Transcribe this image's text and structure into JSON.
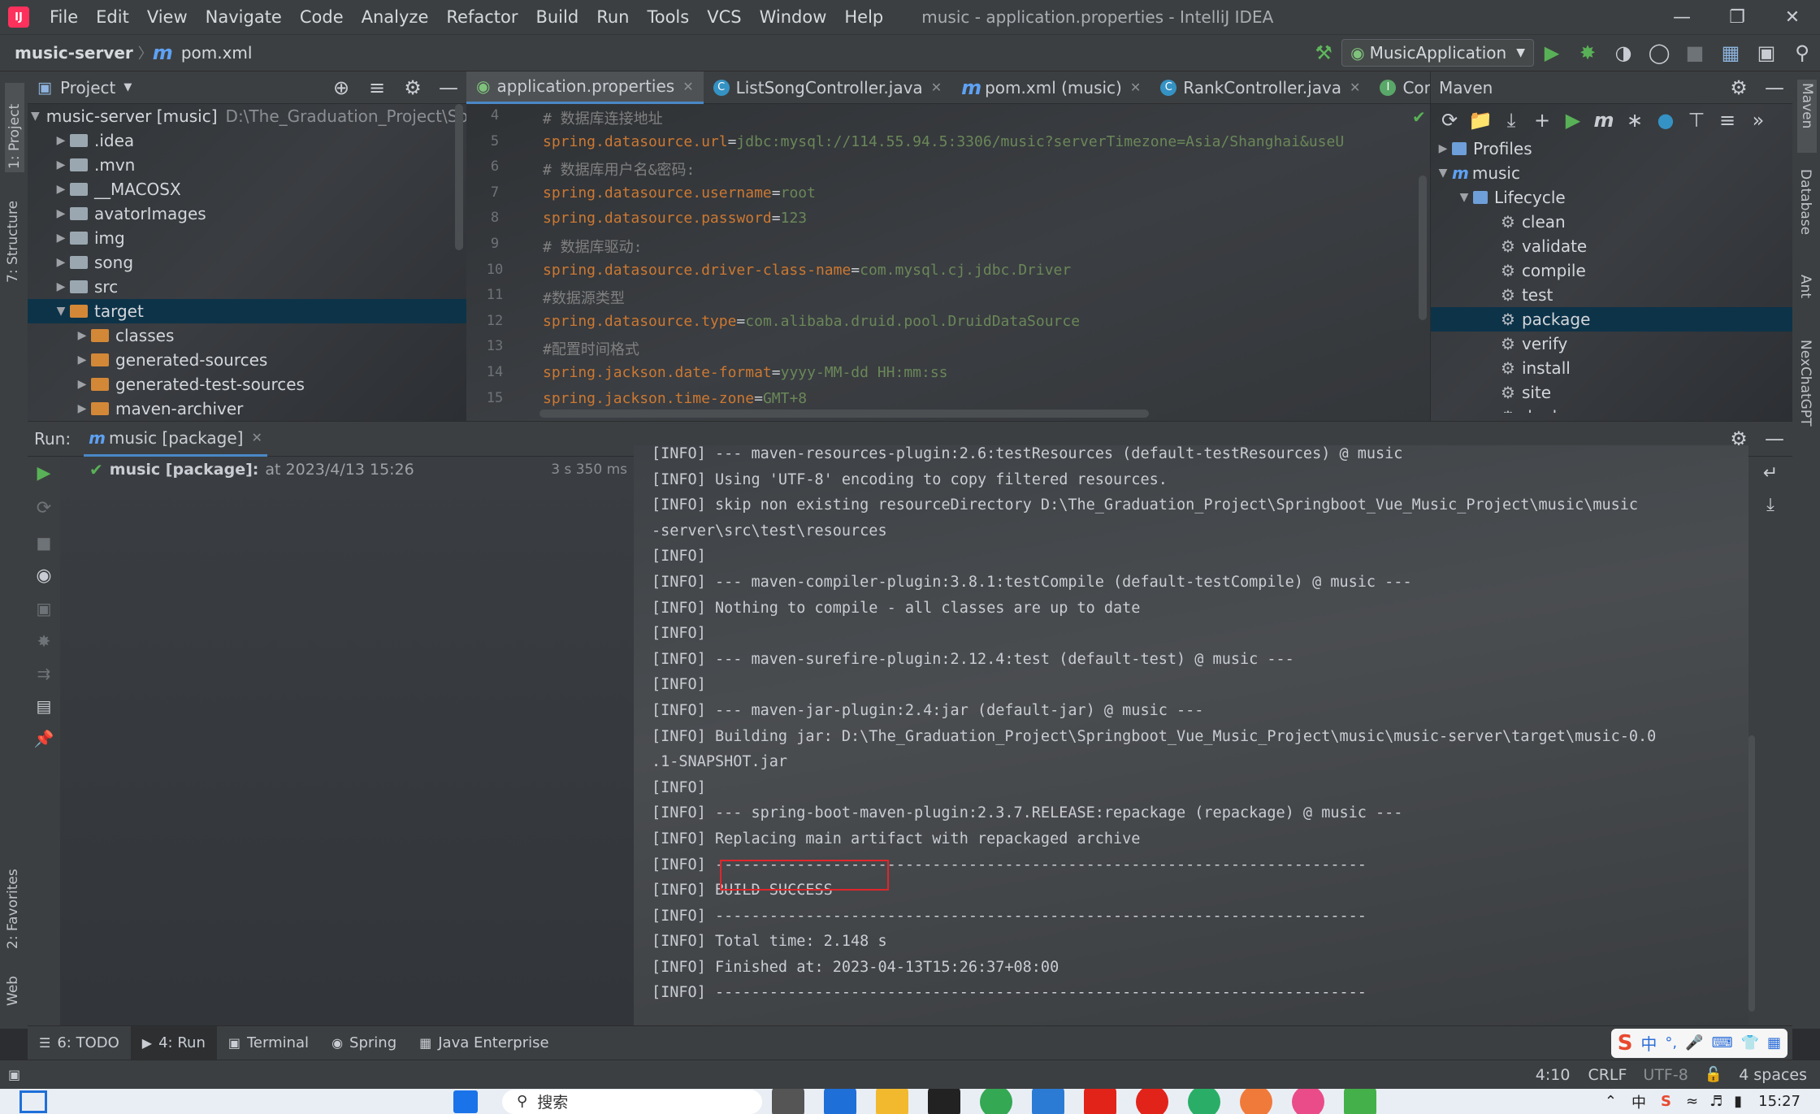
{
  "menu": {
    "items": [
      "File",
      "Edit",
      "View",
      "Navigate",
      "Code",
      "Analyze",
      "Refactor",
      "Build",
      "Run",
      "Tools",
      "VCS",
      "Window",
      "Help"
    ],
    "window_title": "music - application.properties - IntelliJ IDEA"
  },
  "nav": {
    "project": "music-server",
    "file": "pom.xml",
    "run_config": "MusicApplication"
  },
  "left_strip": {
    "project": "1: Project",
    "structure": "7: Structure",
    "favorites": "2: Favorites",
    "web": "Web"
  },
  "right_strip": {
    "maven": "Maven",
    "database": "Database",
    "ant": "Ant",
    "nexchat": "NexChatGPT"
  },
  "project_panel": {
    "title": "Project",
    "root": {
      "name": "music-server [music]",
      "path": "D:\\The_Graduation_Project\\Sp"
    },
    "items": [
      ".idea",
      ".mvn",
      "__MACOSX",
      "avatorImages",
      "img",
      "song",
      "src",
      "target"
    ],
    "target_children": [
      "classes",
      "generated-sources",
      "generated-test-sources",
      "maven-archiver"
    ]
  },
  "editor": {
    "tabs": [
      "application.properties",
      "ListSongController.java",
      "pom.xml (music)",
      "RankController.java",
      "Consu"
    ],
    "lines": [
      {
        "n": "4",
        "comment": "#  数据库连接地址"
      },
      {
        "n": "5",
        "key": "spring.datasource.url",
        "val": "jdbc:mysql://114.55.94.5:3306/music?serverTimezone=Asia/Shanghai&useU"
      },
      {
        "n": "6",
        "comment": "#  数据库用户名&密码:"
      },
      {
        "n": "7",
        "key": "spring.datasource.username",
        "val": "root"
      },
      {
        "n": "8",
        "key": "spring.datasource.password",
        "val": "123"
      },
      {
        "n": "9",
        "comment": "#  数据库驱动:"
      },
      {
        "n": "10",
        "key": "spring.datasource.driver-class-name",
        "val": "com.mysql.cj.jdbc.Driver"
      },
      {
        "n": "11",
        "comment": "#数据源类型"
      },
      {
        "n": "12",
        "key": "spring.datasource.type",
        "val": "com.alibaba.druid.pool.DruidDataSource"
      },
      {
        "n": "13",
        "comment": "#配置时间格式"
      },
      {
        "n": "14",
        "key": "spring.jackson.date-format",
        "val": "yyyy-MM-dd HH:mm:ss"
      },
      {
        "n": "15",
        "key": "spring.jackson.time-zone",
        "val": "GMT+8"
      }
    ]
  },
  "maven_panel": {
    "title": "Maven",
    "profiles": "Profiles",
    "project": "music",
    "lifecycle": "Lifecycle",
    "goals": [
      "clean",
      "validate",
      "compile",
      "test",
      "package",
      "verify",
      "install",
      "site",
      "deploy"
    ]
  },
  "run_panel": {
    "label": "Run:",
    "tab": "music [package]",
    "entry_name": "music [package]:",
    "entry_time": "at 2023/4/13 15:26",
    "duration": "3 s 350 ms",
    "console": [
      "[INFO] --- maven-resources-plugin:2.6:testResources (default-testResources) @ music",
      "[INFO] Using 'UTF-8' encoding to copy filtered resources.",
      "[INFO] skip non existing resourceDirectory D:\\The_Graduation_Project\\Springboot_Vue_Music_Project\\music\\music",
      " -server\\src\\test\\resources",
      "[INFO]",
      "[INFO] --- maven-compiler-plugin:3.8.1:testCompile (default-testCompile) @ music ---",
      "[INFO] Nothing to compile - all classes are up to date",
      "[INFO]",
      "[INFO] --- maven-surefire-plugin:2.12.4:test (default-test) @ music ---",
      "[INFO]",
      "[INFO] --- maven-jar-plugin:2.4:jar (default-jar) @ music ---",
      "[INFO] Building jar: D:\\The_Graduation_Project\\Springboot_Vue_Music_Project\\music\\music-server\\target\\music-0.0",
      " .1-SNAPSHOT.jar",
      "[INFO]",
      "[INFO] --- spring-boot-maven-plugin:2.3.7.RELEASE:repackage (repackage) @ music ---",
      "[INFO] Replacing main artifact with repackaged archive",
      "[INFO] ------------------------------------------------------------------------",
      "[INFO] BUILD SUCCESS",
      "[INFO] ------------------------------------------------------------------------",
      "[INFO] Total time:  2.148 s",
      "[INFO] Finished at: 2023-04-13T15:26:37+08:00",
      "[INFO] ------------------------------------------------------------------------"
    ]
  },
  "bottom_tabs": [
    "6: TODO",
    "4: Run",
    "Terminal",
    "Spring",
    "Java Enterprise"
  ],
  "status": {
    "position": "4:10",
    "line_sep": "CRLF",
    "encoding": "UTF-8",
    "indent": "4 spaces"
  },
  "ime": {
    "lang": "中"
  },
  "taskbar": {
    "search": "搜索",
    "time": "15:27",
    "lang_icon": "中"
  }
}
